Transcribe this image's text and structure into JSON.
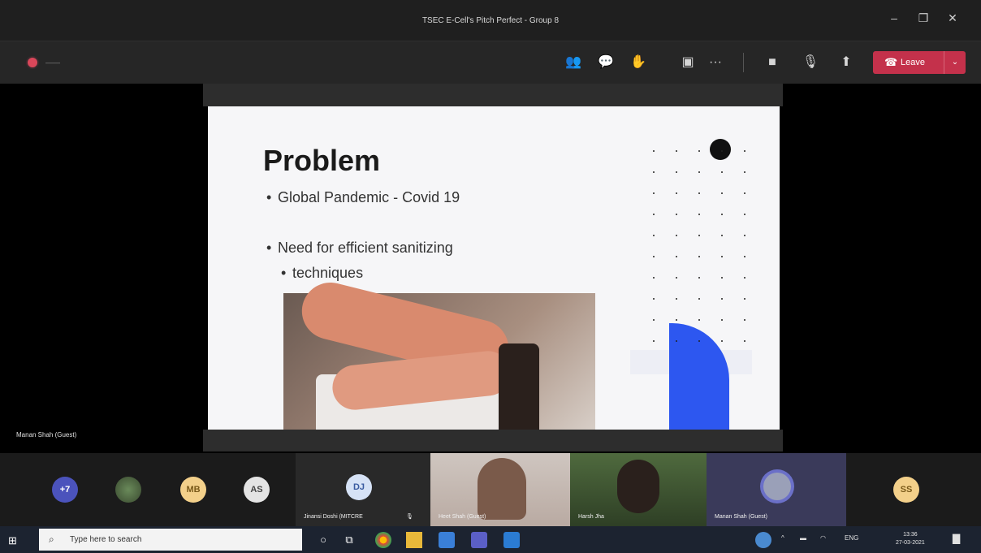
{
  "window": {
    "title": "TSEC E-Cell's Pitch Perfect - Group 8",
    "minimize": "–",
    "maximize": "❐",
    "close": "✕"
  },
  "toolbar": {
    "timer": "——",
    "icons": [
      "people-icon",
      "chat-icon",
      "raise-hand-icon",
      "rooms-icon",
      "more-icon",
      "camera-icon",
      "mic-off-icon",
      "share-icon"
    ],
    "glyphs": {
      "people": "👥",
      "chat": "💬",
      "hand": "✋",
      "rooms": "▣",
      "more": "···",
      "camera": "■",
      "mic": "🎙",
      "share": "⬆"
    },
    "leave_label": "Leave",
    "leave_glyph": "☎",
    "leave_dropdown": "⌄"
  },
  "slide": {
    "title": "Problem",
    "bullets": [
      "Global Pandemic - Covid 19",
      "Need for efficient sanitizing",
      "techniques"
    ]
  },
  "presenter_name": "Manan Shah (Guest)",
  "participants": {
    "overflow": "+7",
    "avatars": [
      {
        "initials": "MB",
        "color": "#f3d08a"
      },
      {
        "initials": "AS",
        "color": "#e4e4e4"
      },
      {
        "initials": "DJ",
        "color": "#d6e2f6"
      },
      {
        "initials": "SS",
        "color": "#f3d08a"
      }
    ],
    "tiles": [
      {
        "label": "Jinansi Doshi (MITCRE",
        "pin": "🎙"
      },
      {
        "label": "Heet Shah (Guest)"
      },
      {
        "label": "Harsh Jha"
      },
      {
        "label": "Manan Shah (Guest)"
      }
    ]
  },
  "taskbar": {
    "start_glyph": "⊞",
    "search_glyph": "⌕",
    "search_placeholder": "Type here to search",
    "cortana": "○",
    "taskview": "⧉",
    "lang": "ENG",
    "time": "13:36",
    "date": "27-03-2021",
    "notification": "▇"
  }
}
